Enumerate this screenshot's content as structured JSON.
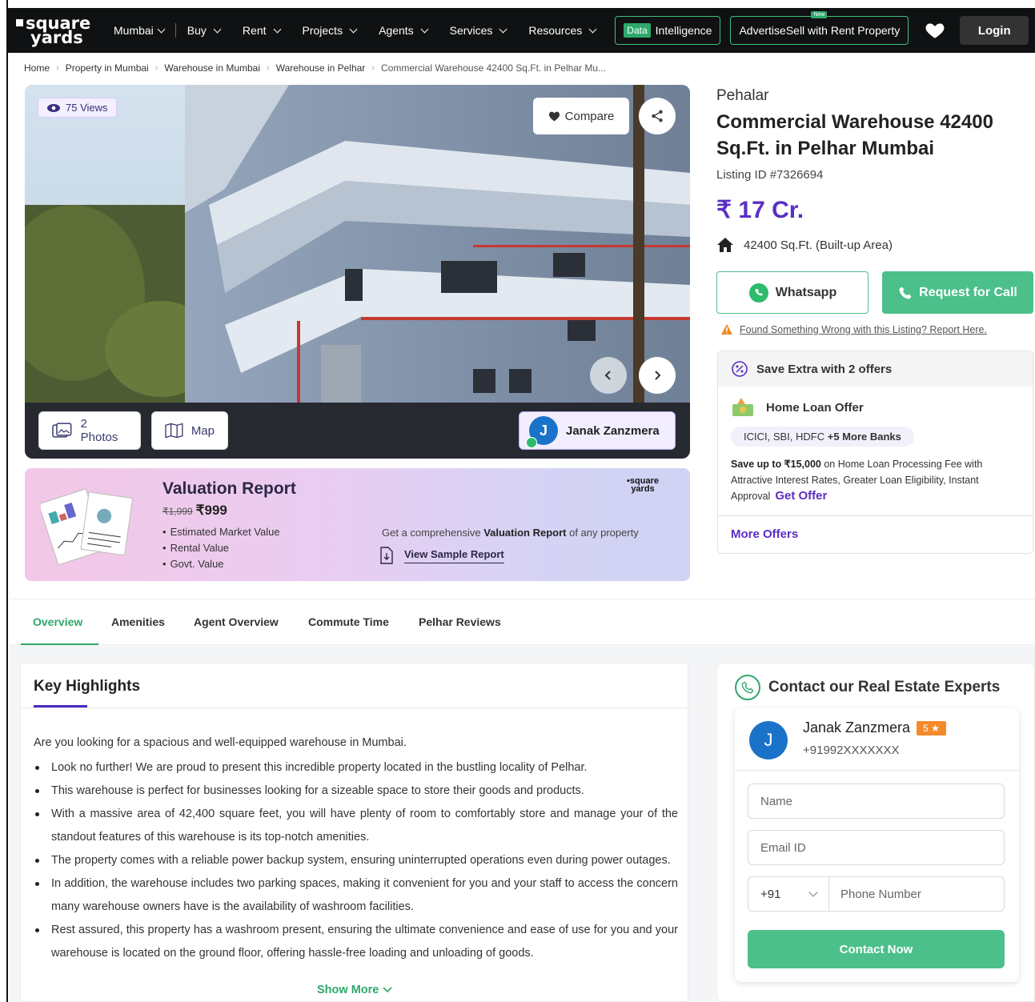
{
  "nav": {
    "logo_line1": "square",
    "logo_line2": "yards",
    "items": [
      {
        "label": "Mumbai"
      },
      {
        "label": "Buy"
      },
      {
        "label": "Rent"
      },
      {
        "label": "Projects"
      },
      {
        "label": "Agents"
      },
      {
        "label": "Services"
      },
      {
        "label": "Resources"
      }
    ],
    "data_badge": "Data",
    "data_label": "Intelligence",
    "advertise_label": "AdvertiseSell with Rent Property",
    "advertise_new": "New",
    "login": "Login"
  },
  "breadcrumb": [
    "Home",
    "Property in Mumbai",
    "Warehouse in Mumbai",
    "Warehouse in Pelhar",
    "Commercial Warehouse 42400 Sq.Ft. in Pelhar Mu..."
  ],
  "gallery": {
    "views": "75 Views",
    "compare": "Compare",
    "photos": "2 Photos",
    "map": "Map",
    "agent_initial": "J",
    "agent_name": "Janak Zanzmera"
  },
  "valuation": {
    "title": "Valuation Report",
    "old_price": "₹1,999",
    "price": "₹999",
    "items": [
      "Estimated Market Value",
      "Rental Value",
      "Govt. Value"
    ],
    "logo_line1": "square",
    "logo_line2": "yards",
    "desc_pre": "Get a comprehensive ",
    "desc_bold": "Valuation Report",
    "desc_post": " of any property",
    "sample": "View Sample Report"
  },
  "property": {
    "locality": "Pehalar",
    "title": "Commercial Warehouse 42400 Sq.Ft. in Pelhar Mumbai",
    "listing_id": "Listing ID #7326694",
    "price": "₹ 17 Cr.",
    "area": "42400 Sq.Ft. (Built-up Area)",
    "whatsapp": "Whatsapp",
    "request_call": "Request for Call",
    "report": "Found Something Wrong with this Listing? Report Here."
  },
  "offers": {
    "header": "Save Extra with 2 offers",
    "home_loan": "Home Loan Offer",
    "banks": "ICICI, SBI, HDFC",
    "banks_more": "+5 More Banks",
    "text_bold": "Save up to ₹15,000",
    "text_rest": " on Home Loan Processing Fee with Attractive Interest Rates, Greater Loan Eligibility, Instant Approval",
    "get_offer": "Get Offer",
    "more_offers": "More Offers"
  },
  "tabs": [
    "Overview",
    "Amenities",
    "Agent Overview",
    "Commute Time",
    "Pelhar Reviews"
  ],
  "highlights": {
    "title": "Key Highlights",
    "intro": "Are you looking for a spacious and well-equipped warehouse in Mumbai.",
    "points": [
      "Look no further! We are proud to present this incredible property located in the bustling locality of Pelhar.",
      "This warehouse is perfect for businesses looking for a sizeable space to store their goods and products.",
      "With a massive area of 42,400 square feet, you will have plenty of room to comfortably store and manage your of the standout features of this warehouse is its top-notch amenities.",
      "The property comes with a reliable power backup system, ensuring uninterrupted operations even during power outages.",
      "In addition, the warehouse includes two parking spaces, making it convenient for you and your staff to access the concern many warehouse owners have is the availability of washroom facilities.",
      "Rest assured, this property has a washroom present, ensuring the ultimate convenience and ease of use for you and your warehouse is located on the ground floor, offering hassle-free loading and unloading of goods."
    ],
    "show_more": "Show More"
  },
  "contact": {
    "title": "Contact our Real Estate Experts",
    "agent_initial": "J",
    "agent_name": "Janak Zanzmera",
    "rating": "5 ★",
    "phone_masked": "+91992XXXXXXX",
    "name_placeholder": "Name",
    "email_placeholder": "Email ID",
    "country_code": "+91",
    "phone_placeholder": "Phone Number",
    "submit": "Contact Now"
  },
  "colors": {
    "brand_purple": "#5a2ec4",
    "brand_green": "#4cc08a",
    "nav_bg": "#0f1112"
  }
}
